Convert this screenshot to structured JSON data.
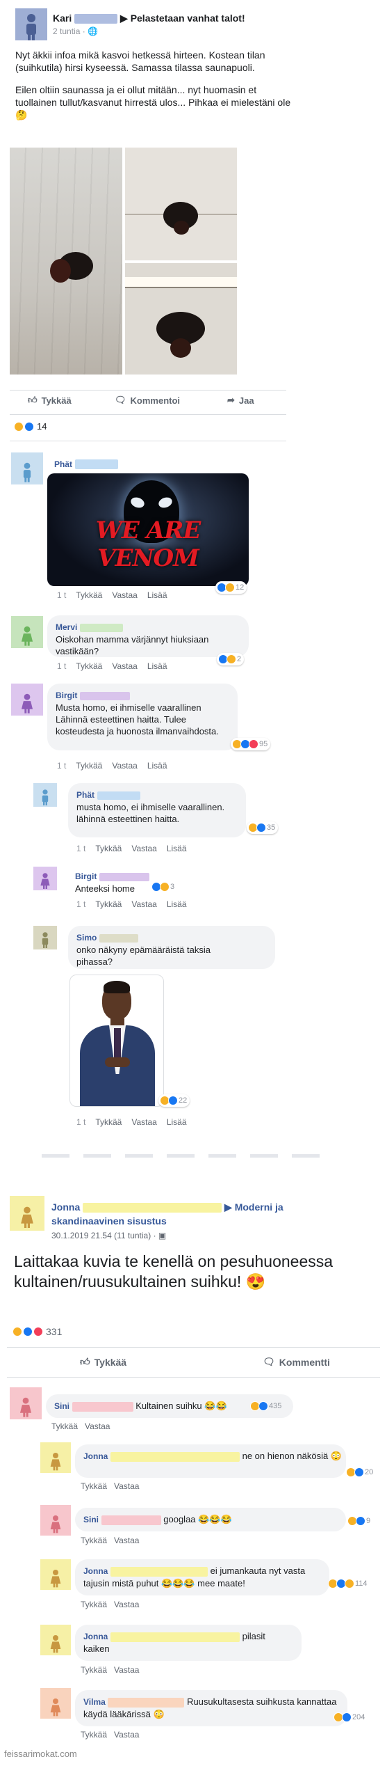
{
  "post1": {
    "author": "Kari",
    "group": "Pelastetaan vanhat talot!",
    "time": "2 tuntia",
    "text1": "Nyt äkkii infoa mikä kasvoi hetkessä hirteen. Kostean tilan (suihkutila) hirsi kyseessä. Samassa tilassa saunapuoli.",
    "text2": "Eilen oltiin saunassa ja ei ollut mitään... nyt huomasin et tuollainen tullut/kasvanut hirrestä ulos... Pihkaa ei mielestäni ole 🤔",
    "like": "Tykkää",
    "comment": "Kommentoi",
    "share": "Jaa",
    "reactions_count": "14",
    "comments": [
      {
        "name": "Phät",
        "image_text": "WE ARE VENOM",
        "time": "1 t",
        "like": "Tykkää",
        "reply": "Vastaa",
        "more": "Lisää",
        "reactions": "12"
      },
      {
        "name": "Mervi",
        "text": "Oiskohan mamma värjännyt hiuksiaan vastikään?",
        "time": "1 t",
        "like": "Tykkää",
        "reply": "Vastaa",
        "more": "Lisää",
        "reactions": "2"
      },
      {
        "name": "Birgit",
        "text": "Musta homo, ei ihmiselle vaarallinen Lähinnä esteettinen haitta. Tulee kosteudesta ja huonosta ilmanvaihdosta.",
        "time": "1 t",
        "like": "Tykkää",
        "reply": "Vastaa",
        "more": "Lisää",
        "reactions": "95"
      },
      {
        "name": "Phät",
        "text": "musta homo, ei ihmiselle vaarallinen. lähinnä esteettinen haitta.",
        "time": "1 t",
        "like": "Tykkää",
        "reply": "Vastaa",
        "more": "Lisää",
        "reactions": "35"
      },
      {
        "name": "Birgit",
        "text": "Anteeksi home",
        "time": "1 t",
        "like": "Tykkää",
        "reply": "Vastaa",
        "more": "Lisää",
        "reactions": "3"
      },
      {
        "name": "Simo",
        "text": "onko näkyny epämääräistä taksia pihassa?",
        "time": "1 t",
        "like": "Tykkää",
        "reply": "Vastaa",
        "more": "Lisää",
        "reactions": "22"
      }
    ]
  },
  "post2": {
    "author": "Jonna",
    "group": "Moderni ja skandinaavinen sisustus",
    "time": "30.1.2019 21.54 (11 tuntia)",
    "text": "Laittakaa kuvia te kenellä on pesuhuoneessa kultainen/ruusukultainen suihku! 😍",
    "reactions_count": "331",
    "like": "Tykkää",
    "comment": "Kommentti",
    "comments": [
      {
        "name": "Sini",
        "text": "Kultainen suihku 😂😂",
        "like": "Tykkää",
        "reply": "Vastaa",
        "reactions": "435"
      },
      {
        "name": "Jonna",
        "text": "ne on hienon näkösiä 😳",
        "like": "Tykkää",
        "reply": "Vastaa",
        "reactions": "20"
      },
      {
        "name": "Sini",
        "text": "googlaa 😂😂😂",
        "like": "Tykkää",
        "reply": "Vastaa",
        "reactions": "9"
      },
      {
        "name": "Jonna",
        "text": "ei jumankauta nyt vasta tajusin mistä puhut 😂😂😂 mee maate!",
        "like": "Tykkää",
        "reply": "Vastaa",
        "reactions": "114"
      },
      {
        "name": "Jonna",
        "text": "pilasit kaiken",
        "like": "Tykkää",
        "reply": "Vastaa"
      },
      {
        "name": "Vilma",
        "text": "Ruusukultasesta suihkusta kannattaa käydä lääkärissä 😳",
        "like": "Tykkää",
        "reply": "Vastaa",
        "reactions": "204"
      }
    ]
  },
  "watermark": "feissarimokat.com"
}
